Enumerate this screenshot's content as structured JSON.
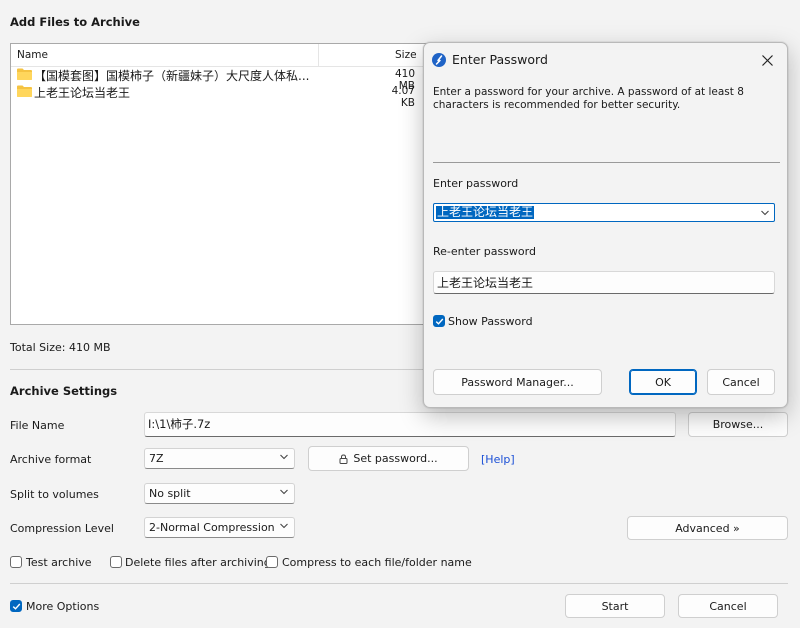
{
  "main": {
    "title": "Add Files to Archive",
    "file_list": {
      "columns": {
        "name": "Name",
        "size": "Size"
      },
      "rows": [
        {
          "name": "【国模套图】国模柿子（新疆妹子）大尺度人体私...",
          "size": "410 MB"
        },
        {
          "name": "上老王论坛当老王",
          "size": "4.07 KB"
        }
      ]
    },
    "total_size": "Total Size: 410 MB"
  },
  "settings": {
    "title": "Archive Settings",
    "file_name_label": "File Name",
    "file_name_value": "I:\\1\\柿子.7z",
    "browse_label": "Browse...",
    "format_label": "Archive format",
    "format_value": "7Z",
    "set_password_label": "Set password...",
    "help_label": "[Help]",
    "split_label": "Split to volumes",
    "split_value": "No split",
    "compression_label": "Compression Level",
    "compression_value": "2-Normal Compression",
    "advanced_label": "Advanced »",
    "test_archive_label": "Test archive",
    "delete_files_label": "Delete files after archiving",
    "compress_each_label": "Compress to each file/folder name",
    "more_options_label": "More Options",
    "start_label": "Start",
    "cancel_label": "Cancel"
  },
  "dialog": {
    "title": "Enter Password",
    "description": "Enter a password for your archive. A password of at least 8 characters is recommended for better security.",
    "enter_label": "Enter password",
    "enter_value": "上老王论坛当老王",
    "reenter_label": "Re-enter password",
    "reenter_value": "上老王论坛当老王",
    "show_password_label": "Show Password",
    "manager_label": "Password Manager...",
    "ok_label": "OK",
    "cancel_label": "Cancel"
  },
  "colors": {
    "accent": "#0067c0",
    "link": "#1a4fd6",
    "folder": "#f5c342"
  },
  "icons": [
    "folder-icon",
    "lock-icon",
    "chevron-down-icon",
    "close-icon",
    "app-icon",
    "checkmark-icon"
  ]
}
